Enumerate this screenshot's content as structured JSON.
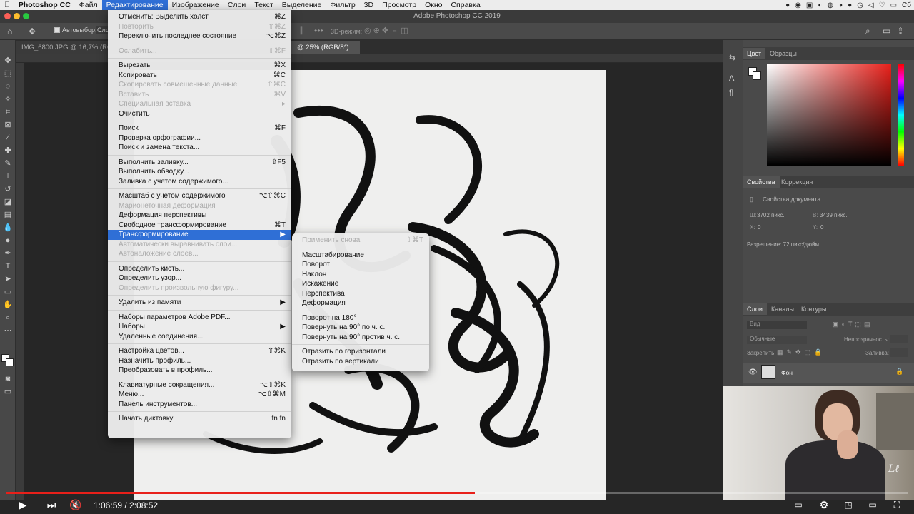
{
  "menubar": {
    "app": "Photoshop CC",
    "items": [
      "Файл",
      "Редактирование",
      "Изображение",
      "Слои",
      "Текст",
      "Выделение",
      "Фильтр",
      "3D",
      "Просмотр",
      "Окно",
      "Справка"
    ],
    "clock": "Сб"
  },
  "window": {
    "title": "Adobe Photoshop CC 2019"
  },
  "options": {
    "autoselect_label": "Автовыбор:",
    "autoselect_value": "Сло",
    "mode3d_label": "3D-режим:"
  },
  "tabs": [
    {
      "label": "IMG_6800.JPG @ 16,7% (RG"
    },
    {
      "label": "@ 25% (RGB/8*)"
    }
  ],
  "edit_menu": [
    {
      "label": "Отменить: Выделить холст",
      "shortcut": "⌘Z",
      "disabled": false
    },
    {
      "label": "Повторить",
      "shortcut": "⇧⌘Z",
      "disabled": true
    },
    {
      "label": "Переключить последнее состояние",
      "shortcut": "⌥⌘Z",
      "disabled": false
    },
    {
      "sep": true
    },
    {
      "label": "Ослабить...",
      "shortcut": "⇧⌘F",
      "disabled": true
    },
    {
      "sep": true
    },
    {
      "label": "Вырезать",
      "shortcut": "⌘X",
      "disabled": false
    },
    {
      "label": "Копировать",
      "shortcut": "⌘C",
      "disabled": false
    },
    {
      "label": "Скопировать совмещенные данные",
      "shortcut": "⇧⌘C",
      "disabled": true
    },
    {
      "label": "Вставить",
      "shortcut": "⌘V",
      "disabled": true
    },
    {
      "label": "Специальная вставка",
      "shortcut": "▸",
      "disabled": true
    },
    {
      "label": "Очистить",
      "shortcut": "",
      "disabled": false
    },
    {
      "sep": true
    },
    {
      "label": "Поиск",
      "shortcut": "⌘F",
      "disabled": false
    },
    {
      "label": "Проверка орфографии...",
      "shortcut": "",
      "disabled": false
    },
    {
      "label": "Поиск и замена текста...",
      "shortcut": "",
      "disabled": false
    },
    {
      "sep": true
    },
    {
      "label": "Выполнить заливку...",
      "shortcut": "⇧F5",
      "disabled": false
    },
    {
      "label": "Выполнить обводку...",
      "shortcut": "",
      "disabled": false
    },
    {
      "label": "Заливка с учетом содержимого...",
      "shortcut": "",
      "disabled": false
    },
    {
      "sep": true
    },
    {
      "label": "Масштаб с учетом содержимого",
      "shortcut": "⌥⇧⌘C",
      "disabled": false
    },
    {
      "label": "Марионеточная деформация",
      "shortcut": "",
      "disabled": true
    },
    {
      "label": "Деформация перспективы",
      "shortcut": "",
      "disabled": false
    },
    {
      "label": "Свободное трансформирование",
      "shortcut": "⌘T",
      "disabled": false
    },
    {
      "label": "Трансформирование",
      "shortcut": "▶",
      "disabled": false,
      "selected": true
    },
    {
      "label": "Автоматически выравнивать слои...",
      "shortcut": "",
      "disabled": true
    },
    {
      "label": "Автоналожение слоев...",
      "shortcut": "",
      "disabled": true
    },
    {
      "sep": true
    },
    {
      "label": "Определить кисть...",
      "shortcut": "",
      "disabled": false
    },
    {
      "label": "Определить узор...",
      "shortcut": "",
      "disabled": false
    },
    {
      "label": "Определить произвольную фигуру...",
      "shortcut": "",
      "disabled": true
    },
    {
      "sep": true
    },
    {
      "label": "Удалить из памяти",
      "shortcut": "▶",
      "disabled": false
    },
    {
      "sep": true
    },
    {
      "label": "Наборы параметров Adobe PDF...",
      "shortcut": "",
      "disabled": false
    },
    {
      "label": "Наборы",
      "shortcut": "▶",
      "disabled": false
    },
    {
      "label": "Удаленные соединения...",
      "shortcut": "",
      "disabled": false
    },
    {
      "sep": true
    },
    {
      "label": "Настройка цветов...",
      "shortcut": "⇧⌘K",
      "disabled": false
    },
    {
      "label": "Назначить профиль...",
      "shortcut": "",
      "disabled": false
    },
    {
      "label": "Преобразовать в профиль...",
      "shortcut": "",
      "disabled": false
    },
    {
      "sep": true
    },
    {
      "label": "Клавиатурные сокращения...",
      "shortcut": "⌥⇧⌘K",
      "disabled": false
    },
    {
      "label": "Меню...",
      "shortcut": "⌥⇧⌘M",
      "disabled": false
    },
    {
      "label": "Панель инструментов...",
      "shortcut": "",
      "disabled": false
    },
    {
      "sep": true
    },
    {
      "label": "Начать диктовку",
      "shortcut": "fn fn",
      "disabled": false
    }
  ],
  "transform_submenu": [
    {
      "label": "Применить снова",
      "shortcut": "⇧⌘T",
      "disabled": true
    },
    {
      "sep": true
    },
    {
      "label": "Масштабирование",
      "shortcut": "",
      "disabled": false
    },
    {
      "label": "Поворот",
      "shortcut": "",
      "disabled": false
    },
    {
      "label": "Наклон",
      "shortcut": "",
      "disabled": false
    },
    {
      "label": "Искажение",
      "shortcut": "",
      "disabled": false
    },
    {
      "label": "Перспектива",
      "shortcut": "",
      "disabled": false
    },
    {
      "label": "Деформация",
      "shortcut": "",
      "disabled": false
    },
    {
      "sep": true
    },
    {
      "label": "Поворот на 180°",
      "shortcut": "",
      "disabled": false
    },
    {
      "label": "Повернуть на 90° по ч. с.",
      "shortcut": "",
      "disabled": false
    },
    {
      "label": "Повернуть на 90° против ч. с.",
      "shortcut": "",
      "disabled": false
    },
    {
      "sep": true
    },
    {
      "label": "Отразить по горизонтали",
      "shortcut": "",
      "disabled": false
    },
    {
      "label": "Отразить по вертикали",
      "shortcut": "",
      "disabled": false
    }
  ],
  "panels": {
    "color_tabs": [
      "Цвет",
      "Образцы"
    ],
    "props_tabs": [
      "Свойства",
      "Коррекция"
    ],
    "props_title": "Свойства документа",
    "width_label": "Ш:",
    "width_value": "3702 пикс.",
    "height_label": "В:",
    "height_value": "3439 пикс.",
    "x_label": "X:",
    "x_value": "0",
    "y_label": "Y:",
    "y_value": "0",
    "resolution": "Разрешение: 72 пикс/дюйм",
    "layers_tabs": [
      "Слои",
      "Каналы",
      "Контуры"
    ],
    "layer_search": "Вид",
    "blend_mode": "Обычные",
    "opacity_label": "Непрозрачность:",
    "lock_label": "Закрепить:",
    "fill_label": "Заливка:",
    "layer_name": "Фон"
  },
  "player": {
    "time": "1:06:59 / 2:08:52",
    "progress": 0.52
  },
  "colors": {
    "accent": "#2f6fd6",
    "progress": "#e8201a"
  }
}
